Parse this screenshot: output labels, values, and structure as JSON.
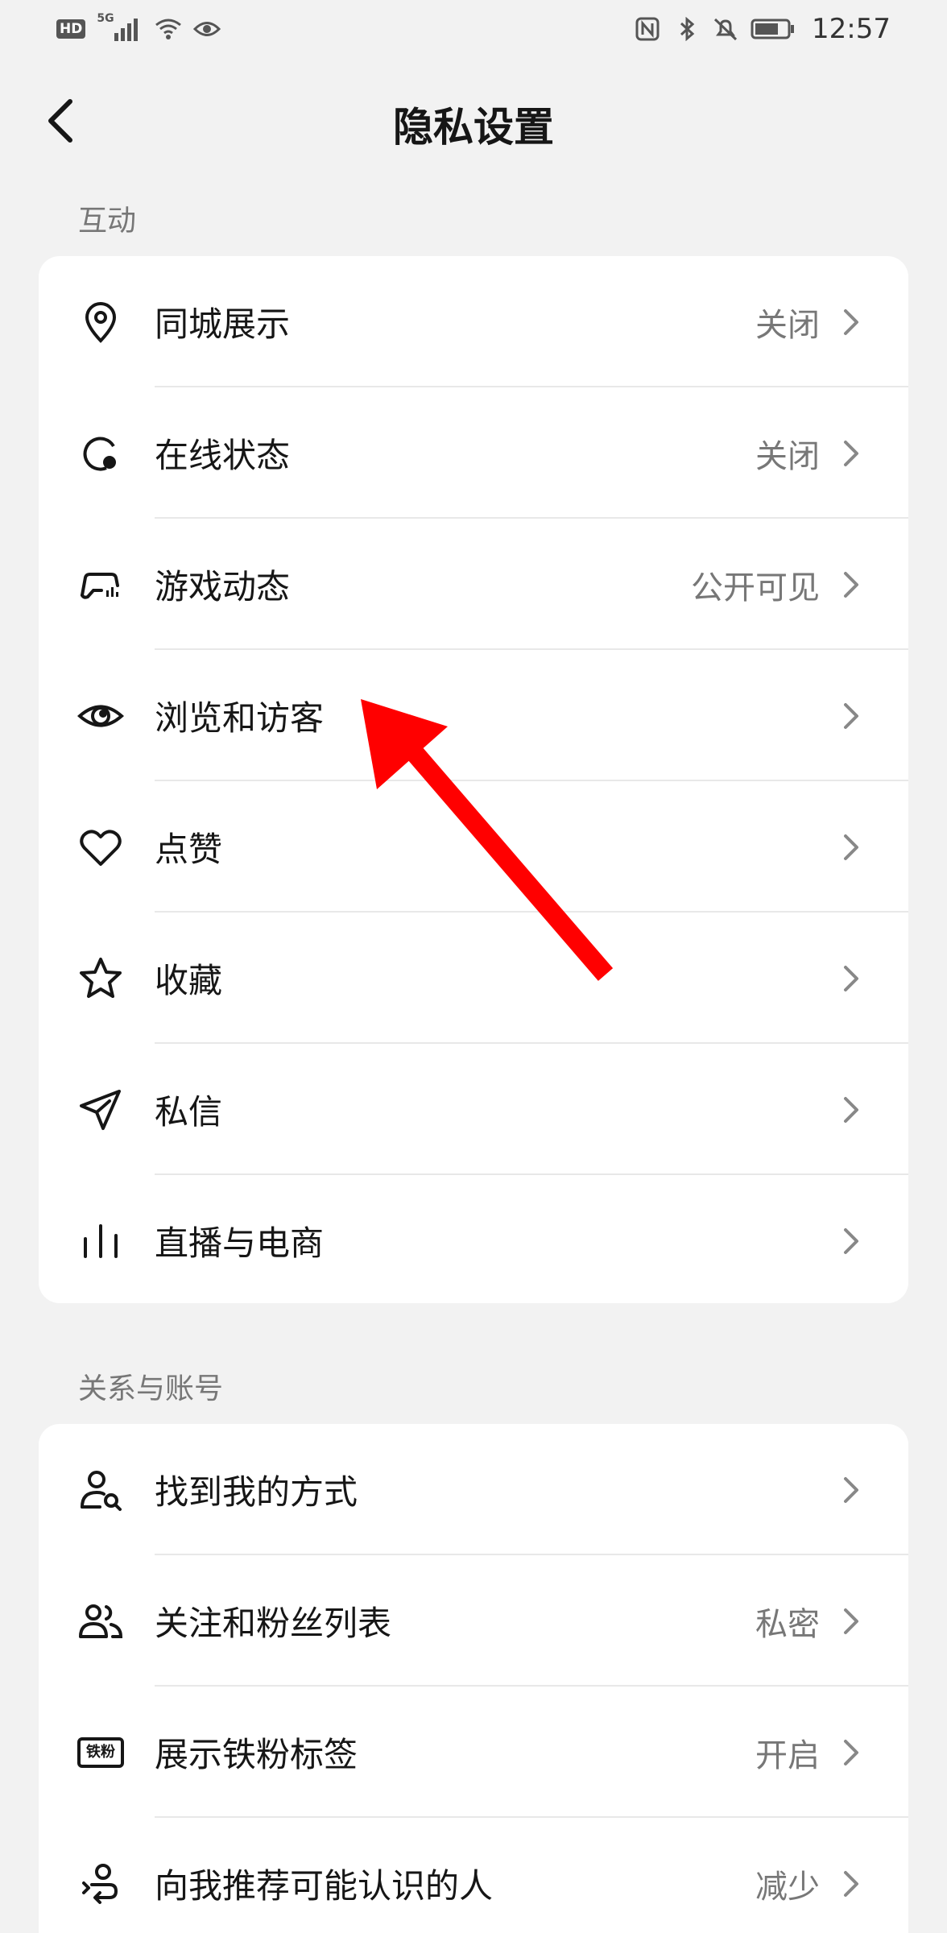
{
  "status_bar": {
    "hd_badge": "HD",
    "net": "5G",
    "time": "12:57",
    "icons": [
      "signal-icon",
      "wifi-icon",
      "eye-icon",
      "nfc-icon",
      "bluetooth-icon",
      "bell-off-icon",
      "battery-icon"
    ]
  },
  "nav": {
    "title": "隐私设置",
    "back_icon": "chevron-left-icon"
  },
  "sections": [
    {
      "label": "互动",
      "items": [
        {
          "icon": "location-pin-icon",
          "label": "同城展示",
          "value": "关闭"
        },
        {
          "icon": "online-status-icon",
          "label": "在线状态",
          "value": "关闭"
        },
        {
          "icon": "game-controller-icon",
          "label": "游戏动态",
          "value": "公开可见"
        },
        {
          "icon": "eye-icon",
          "label": "浏览和访客",
          "value": ""
        },
        {
          "icon": "heart-icon",
          "label": "点赞",
          "value": ""
        },
        {
          "icon": "star-icon",
          "label": "收藏",
          "value": ""
        },
        {
          "icon": "paper-plane-icon",
          "label": "私信",
          "value": ""
        },
        {
          "icon": "bars-icon",
          "label": "直播与电商",
          "value": ""
        }
      ]
    },
    {
      "label": "关系与账号",
      "items": [
        {
          "icon": "user-search-icon",
          "label": "找到我的方式",
          "value": ""
        },
        {
          "icon": "users-icon",
          "label": "关注和粉丝列表",
          "value": "私密"
        },
        {
          "icon": "fan-badge-icon",
          "label": "展示铁粉标签",
          "value": "开启",
          "badge_text": "铁粉"
        },
        {
          "icon": "recommend-user-icon",
          "label": "向我推荐可能认识的人",
          "value": "减少"
        }
      ]
    }
  ],
  "annotation": {
    "color": "#ff0000",
    "icon": "red-arrow-icon"
  }
}
